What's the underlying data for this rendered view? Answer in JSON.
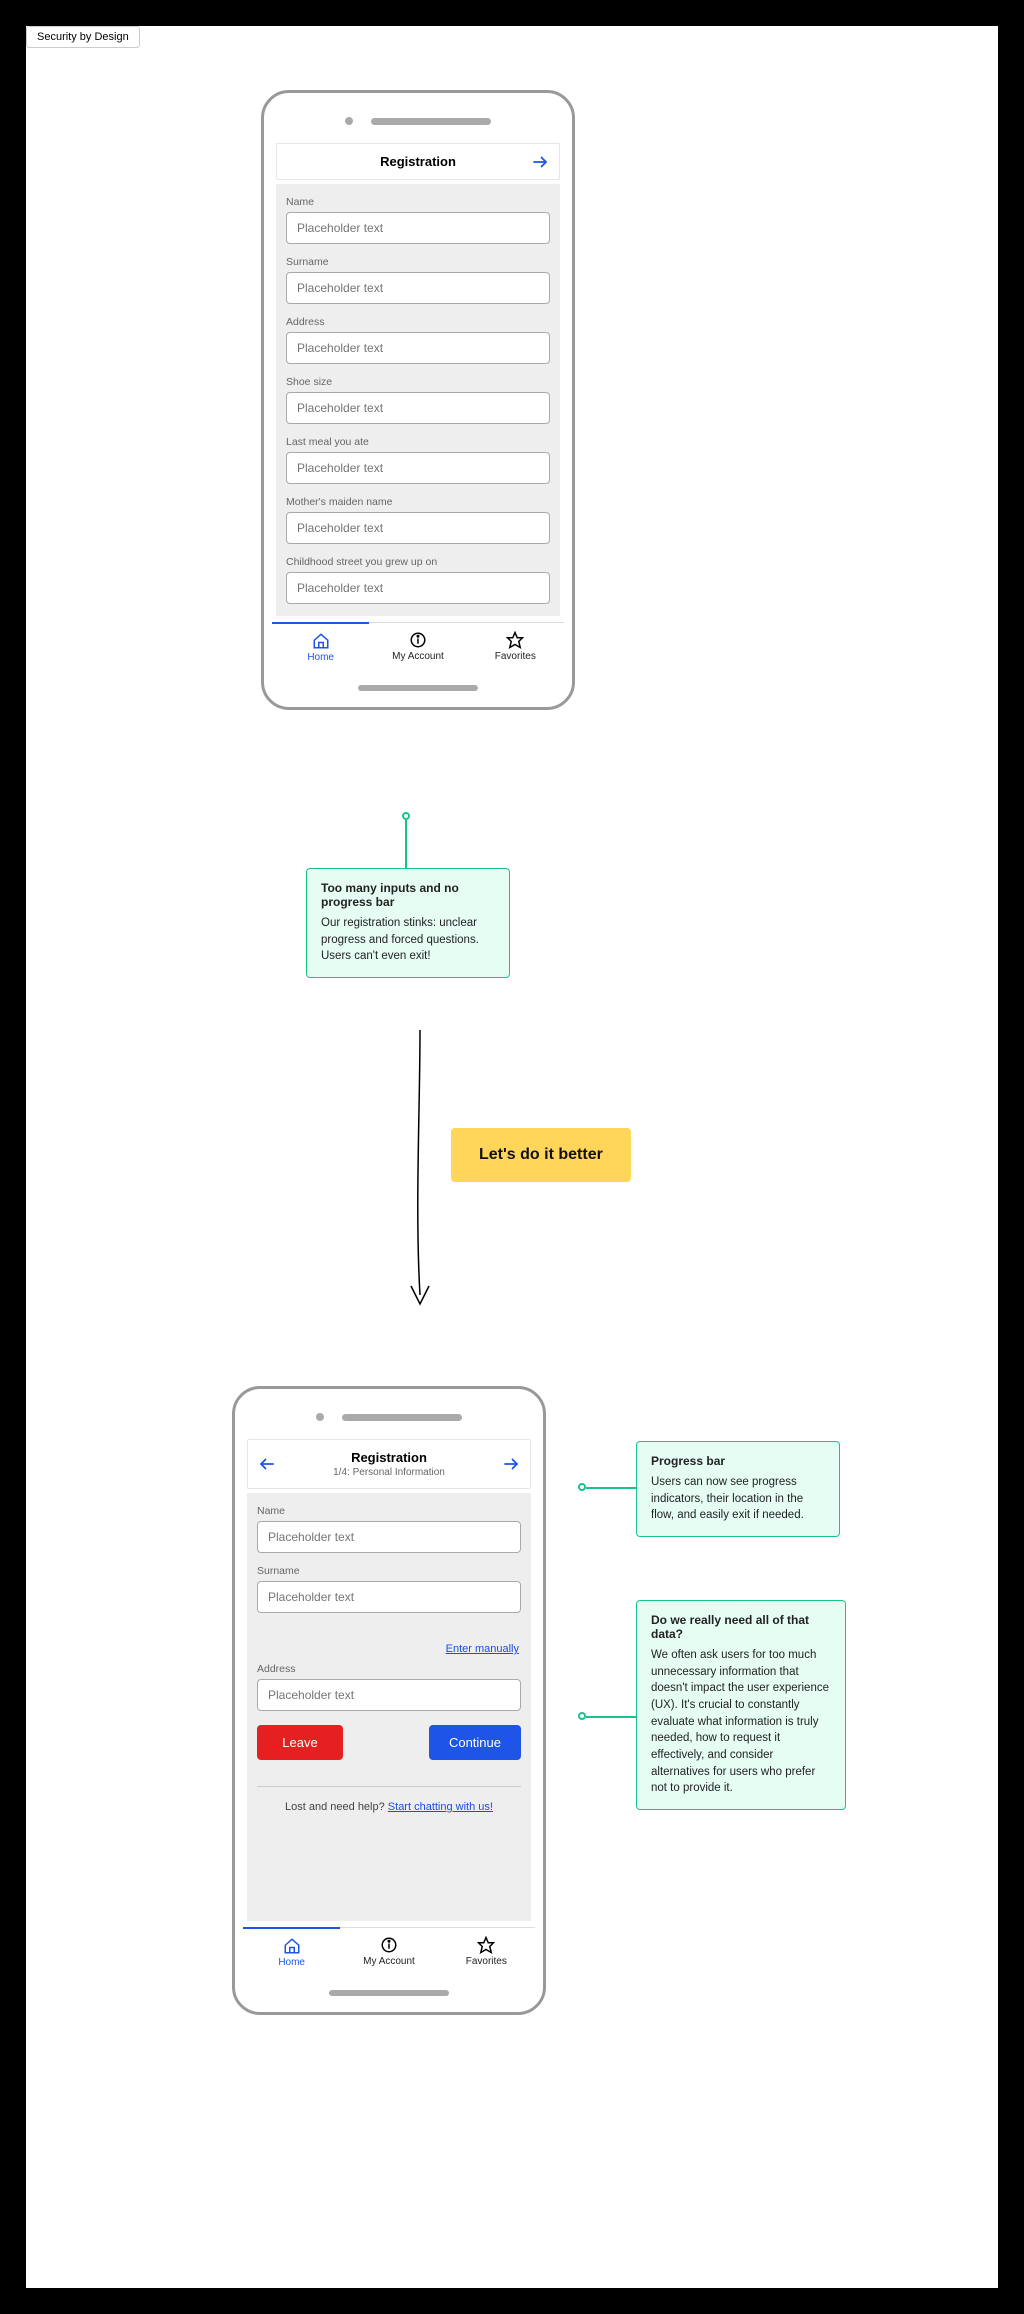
{
  "tab_label": "Security by Design",
  "phone1": {
    "title": "Registration",
    "fields": [
      {
        "label": "Name",
        "placeholder": "Placeholder text"
      },
      {
        "label": "Surname",
        "placeholder": "Placeholder text"
      },
      {
        "label": "Address",
        "placeholder": "Placeholder text"
      },
      {
        "label": "Shoe size",
        "placeholder": "Placeholder text"
      },
      {
        "label": "Last meal you ate",
        "placeholder": "Placeholder text"
      },
      {
        "label": "Mother's maiden name",
        "placeholder": "Placeholder text"
      },
      {
        "label": "Childhood street you grew up on",
        "placeholder": "Placeholder text"
      }
    ],
    "tabs": {
      "home": "Home",
      "account": "My Account",
      "favorites": "Favorites"
    }
  },
  "callout_problem": {
    "title": "Too many inputs and no progress bar",
    "body": "Our registration stinks: unclear progress and forced questions. Users can't even exit!"
  },
  "transition_label": "Let's do it better",
  "phone2": {
    "title": "Registration",
    "subtitle": "1/4: Personal Information",
    "fields": [
      {
        "label": "Name",
        "placeholder": "Placeholder text"
      },
      {
        "label": "Surname",
        "placeholder": "Placeholder text"
      },
      {
        "label": "Address",
        "placeholder": "Placeholder text"
      }
    ],
    "enter_manually": "Enter manually",
    "leave": "Leave",
    "continue": "Continue",
    "help_prefix": "Lost and need help? ",
    "help_link": "Start chatting with us!",
    "tabs": {
      "home": "Home",
      "account": "My Account",
      "favorites": "Favorites"
    }
  },
  "callout_progress": {
    "title": "Progress bar",
    "body": "Users can now see progress indicators, their location in the flow, and easily exit if needed."
  },
  "callout_data": {
    "title": "Do we really need all of that data?",
    "body": "We often ask users for too much unnecessary information that doesn't impact the user experience (UX). It's crucial to constantly evaluate what information is truly needed, how to request it effectively, and consider alternatives for users who prefer not to provide it."
  }
}
